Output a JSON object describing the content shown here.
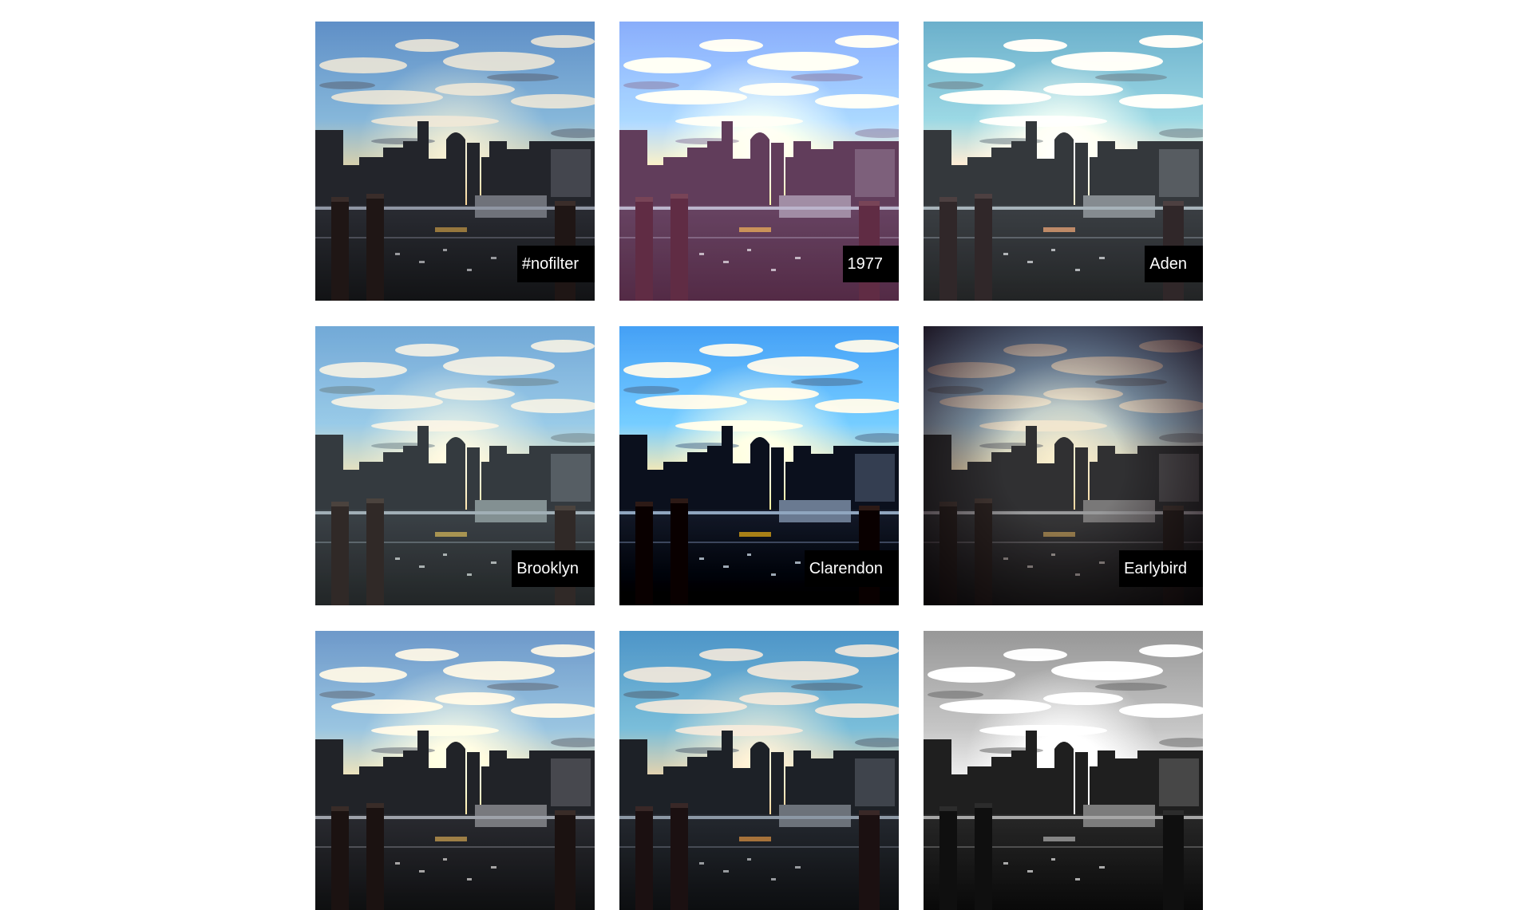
{
  "gallery": {
    "tiles": [
      {
        "label": "#nofilter"
      },
      {
        "label": "1977"
      },
      {
        "label": "Aden"
      },
      {
        "label": "Brooklyn"
      },
      {
        "label": "Clarendon"
      },
      {
        "label": "Earlybird"
      },
      {
        "label": ""
      },
      {
        "label": ""
      },
      {
        "label": ""
      }
    ]
  }
}
